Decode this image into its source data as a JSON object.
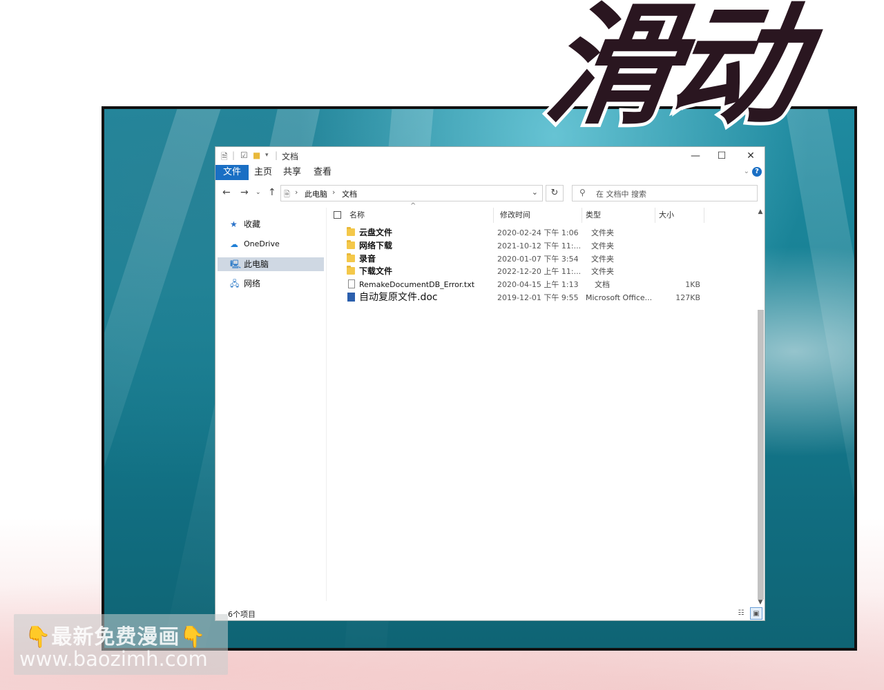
{
  "title_art": "滑动",
  "window": {
    "title": "文档",
    "minimize_label": "—",
    "maximize_label": "☐",
    "close_label": "✕"
  },
  "ribbon": {
    "tabs": [
      "文件",
      "主页",
      "共享",
      "查看"
    ],
    "help_label": "?"
  },
  "address": {
    "crumbs": [
      "此电脑",
      "文档"
    ],
    "search_placeholder": "在 文档中 搜索"
  },
  "nav_pane": {
    "items": [
      {
        "label": "收藏",
        "icon": "star-icon"
      },
      {
        "label": "OneDrive",
        "icon": "cloud-icon"
      },
      {
        "label": "此电脑",
        "icon": "computer-icon",
        "selected": true
      },
      {
        "label": "网络",
        "icon": "network-icon"
      }
    ]
  },
  "columns": [
    "名称",
    "修改时间",
    "类型",
    "大小"
  ],
  "files": [
    {
      "name": "云盘文件",
      "date": "2020-02-24  下午  1:06",
      "type": "文件夹",
      "size": "",
      "kind": "folder"
    },
    {
      "name": "网络下载",
      "date": "2021-10-12  下午  11:...",
      "type": "文件夹",
      "size": "",
      "kind": "folder"
    },
    {
      "name": "录音",
      "date": "2020-01-07  下午  3:54",
      "type": "文件夹",
      "size": "",
      "kind": "folder"
    },
    {
      "name": "下载文件",
      "date": "2022-12-20  上午  11:...",
      "type": "文件夹",
      "size": "",
      "kind": "folder"
    },
    {
      "name": "RemakeDocumentDB_Error.txt",
      "date": "2020-04-15  上午  1:13",
      "type": "文档",
      "size": "1KB",
      "kind": "txt"
    },
    {
      "name": "自动复原文件.doc",
      "date": "2019-12-01  下午  9:55",
      "type": "Microsoft Office...",
      "size": "127KB",
      "kind": "doc"
    }
  ],
  "status": {
    "item_count": "6个项目"
  },
  "watermark": {
    "line1": "最新免费漫画",
    "line2": "www.baozimh.com",
    "hand": "👇"
  }
}
